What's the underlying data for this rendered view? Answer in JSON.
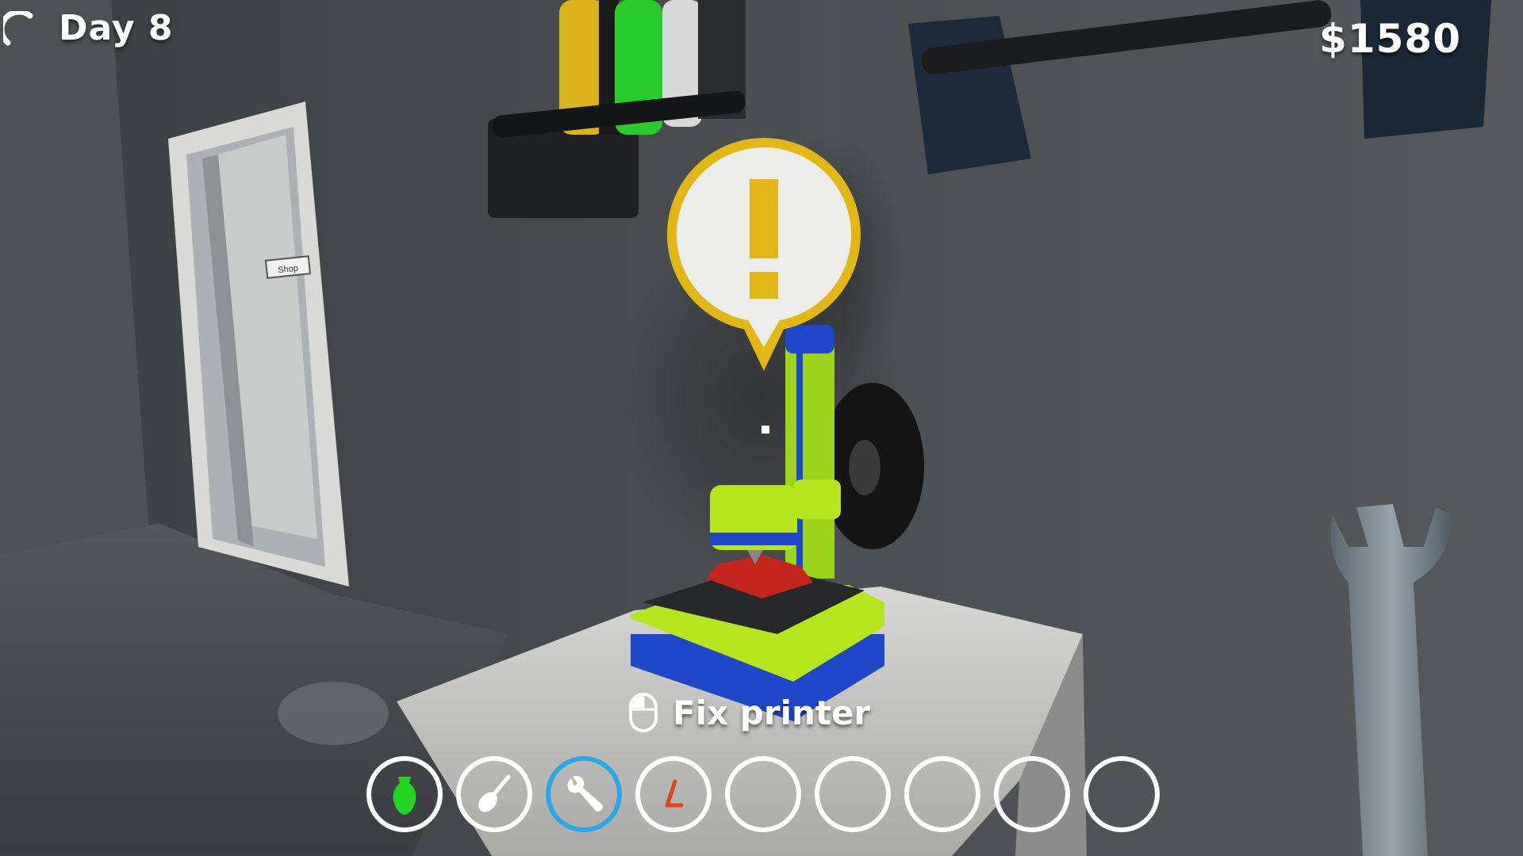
{
  "hud": {
    "day_label": "Day 8",
    "money": "$1580"
  },
  "interaction": {
    "prompt_label": "Fix printer",
    "prompt_icon": "mouse-left-click-icon"
  },
  "world": {
    "door_sign": "Shop",
    "alert_icon": "exclamation-icon",
    "held_item": "wrench"
  },
  "hotbar": {
    "selected_index": 2,
    "slots": [
      {
        "item": "green-vase-icon",
        "filled": true
      },
      {
        "item": "spatula-icon",
        "filled": true
      },
      {
        "item": "wrench-icon",
        "filled": true
      },
      {
        "item": "orange-allen-key-icon",
        "filled": true
      },
      {
        "item": "empty-slot",
        "filled": false
      },
      {
        "item": "empty-slot",
        "filled": false
      },
      {
        "item": "empty-slot",
        "filled": false
      },
      {
        "item": "empty-slot",
        "filled": false
      },
      {
        "item": "empty-slot",
        "filled": false
      }
    ]
  },
  "colors": {
    "selected_slot": "#2ca7e6",
    "alert_ring": "#e2b614",
    "printer_green": "#b5e61d",
    "printer_blue": "#1f47c9"
  }
}
